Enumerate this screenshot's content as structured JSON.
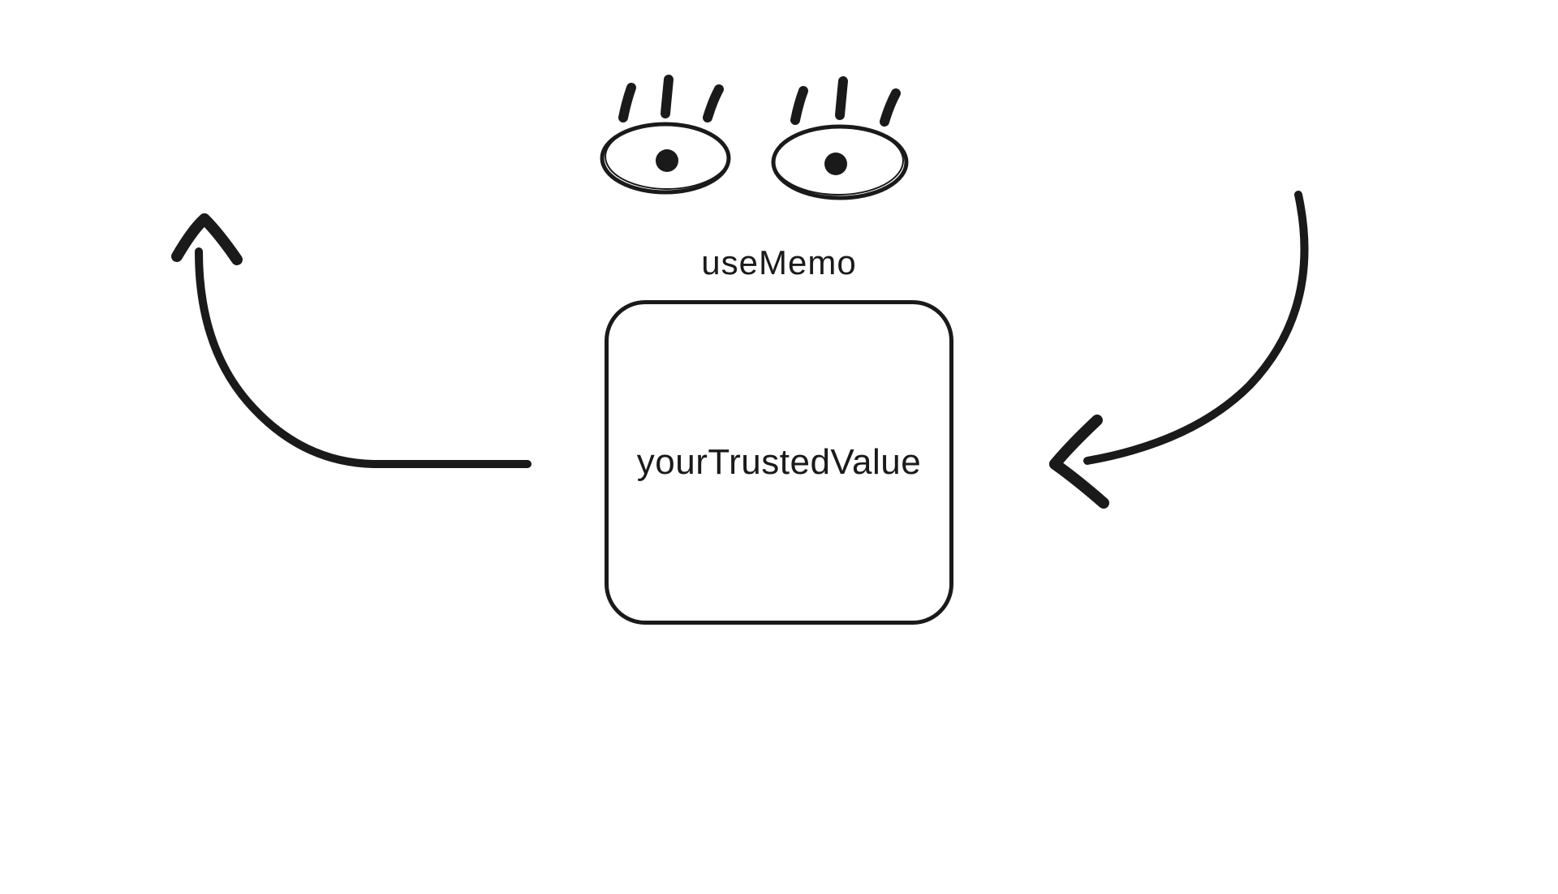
{
  "title_label": "useMemo",
  "box_label": "yourTrustedValue"
}
